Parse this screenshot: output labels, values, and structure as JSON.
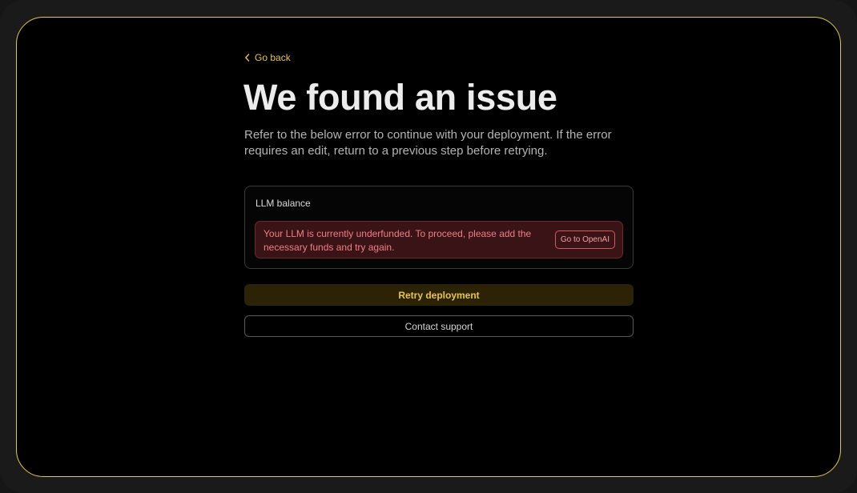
{
  "nav": {
    "back_label": "Go back",
    "back_icon": "chevron-left-icon"
  },
  "page": {
    "title": "We found an issue",
    "subtitle": "Refer to the below error to continue with your deployment. If the error requires an edit, return to a previous step before retrying."
  },
  "error_card": {
    "title": "LLM balance",
    "message": "Your LLM is currently underfunded. To proceed, please add the necessary funds and try again.",
    "action_label": "Go to OpenAI"
  },
  "actions": {
    "retry_label": "Retry deployment",
    "support_label": "Contact support"
  },
  "colors": {
    "accent": "#e8c544",
    "error_text": "#ef7f84",
    "error_bg": "#3a1317",
    "background": "#000000"
  }
}
